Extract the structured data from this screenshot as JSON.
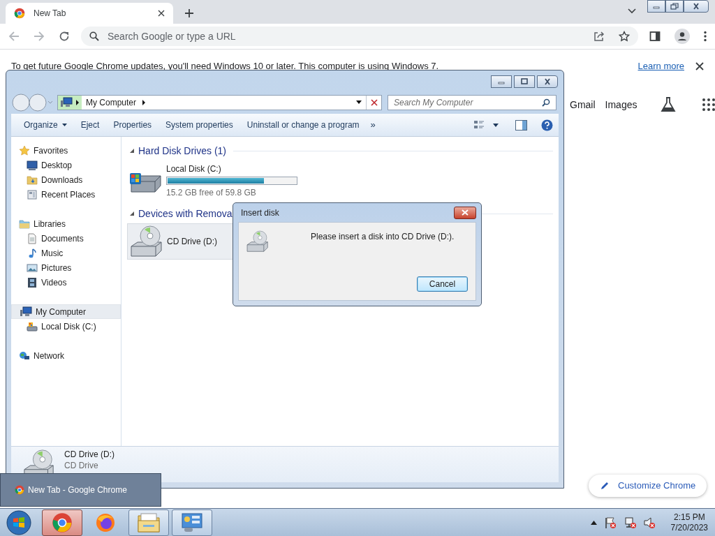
{
  "browser": {
    "tabs": [
      {
        "title": "New Tab",
        "selected": true
      }
    ],
    "omnibox": {
      "placeholder": "Search Google or type a URL"
    },
    "infobar": {
      "message": "To get future Google Chrome updates, you'll need Windows 10 or later. This computer is using Windows 7.",
      "link": "Learn more"
    },
    "links": [
      "Gmail",
      "Images"
    ],
    "customize": "Customize Chrome"
  },
  "explorer": {
    "address": [
      "My Computer"
    ],
    "search": {
      "placeholder": "Search My Computer"
    },
    "commands": [
      {
        "label": "Organize",
        "menu": true
      },
      {
        "label": "Eject",
        "menu": false
      },
      {
        "label": "Properties",
        "menu": false
      },
      {
        "label": "System properties",
        "menu": false
      },
      {
        "label": "Uninstall or change a program",
        "menu": false
      }
    ],
    "more": "»",
    "nav": [
      {
        "label": "Favorites",
        "kind": "star",
        "selected": false,
        "children": [
          {
            "label": "Desktop",
            "kind": "desktop",
            "selected": false
          },
          {
            "label": "Downloads",
            "kind": "downloads",
            "selected": false
          },
          {
            "label": "Recent Places",
            "kind": "recent",
            "selected": false
          }
        ]
      },
      {
        "label": "Libraries",
        "kind": "libraries",
        "selected": false,
        "children": [
          {
            "label": "Documents",
            "kind": "documents",
            "selected": false
          },
          {
            "label": "Music",
            "kind": "music",
            "selected": false
          },
          {
            "label": "Pictures",
            "kind": "pictures",
            "selected": false
          },
          {
            "label": "Videos",
            "kind": "videos",
            "selected": false
          }
        ]
      },
      {
        "label": "My Computer",
        "kind": "computer",
        "selected": true,
        "children": [
          {
            "label": "Local Disk (C:)",
            "kind": "disk",
            "selected": false
          }
        ]
      },
      {
        "label": "Network",
        "kind": "network",
        "selected": false
      }
    ],
    "sections": [
      {
        "title": "Hard Disk Drives (1)",
        "items": [
          {
            "kind": "disk",
            "name": "Local Disk (C:)",
            "level": 0.75,
            "reading": "15.2 GB free of 59.8 GB",
            "selected": false
          }
        ]
      },
      {
        "title": "Devices with Remova",
        "items": [
          {
            "kind": "cd",
            "name": "CD Drive (D:)",
            "selected": true
          }
        ]
      }
    ],
    "details": {
      "name": "CD Drive (D:)",
      "type": "CD Drive"
    }
  },
  "dialog": {
    "title": "Insert disk",
    "message": "Please insert a disk into CD Drive (D:).",
    "button": "Cancel"
  },
  "taskbar": {
    "preview": "New Tab - Google Chrome",
    "buttons": [
      {
        "kind": "chrome",
        "running": true,
        "selected": true
      },
      {
        "kind": "firefox",
        "running": false,
        "selected": false
      },
      {
        "kind": "folder",
        "running": true,
        "selected": false
      },
      {
        "kind": "control-panel",
        "running": true,
        "selected": false
      }
    ],
    "time": "2:15 PM",
    "date": "7/20/2023"
  }
}
